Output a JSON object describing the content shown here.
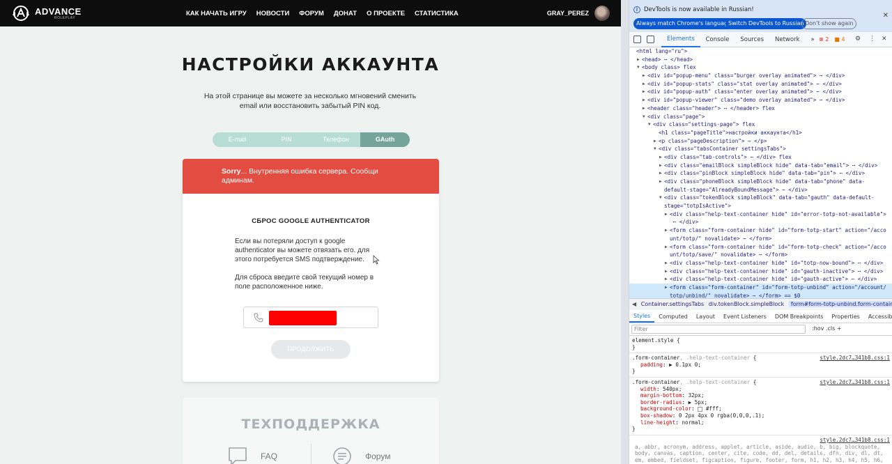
{
  "site": {
    "logo": {
      "name": "ADVANCE",
      "sub": "ROLEPLAY"
    },
    "nav": [
      "КАК НАЧАТЬ ИГРУ",
      "НОВОСТИ",
      "ФОРУМ",
      "ДОНАТ",
      "О ПРОЕКТЕ",
      "СТАТИСТИКА"
    ],
    "username": "GRAY_PEREZ",
    "page_title": "НАСТРОЙКИ АККАУНТА",
    "page_description": "На этой странице вы можете за несколько мгновений сменить email или восстановить забытый PIN код.",
    "tabs": [
      {
        "label": "E-mail",
        "active": false
      },
      {
        "label": "PIN",
        "active": false
      },
      {
        "label": "Телефон",
        "active": false
      },
      {
        "label": "GAuth",
        "active": true
      }
    ],
    "error": {
      "strong": "Sorry",
      "message": "... Внутренняя ошибка сервера. Сообщи админам."
    },
    "card": {
      "heading": "СБРОС GOOGLE AUTHENTICATOR",
      "para1": "Если вы потеряли доступ к google authenticator вы можете отвязать его. для этого потребуется SMS подтверждение.",
      "para2": "Для сброса введите свой текущий номер в поле расположенное ниже.",
      "continue_label": "ПРОДОЛЖИТЬ"
    },
    "support": {
      "title": "ТЕХПОДДЕРЖКА",
      "faq": "FAQ",
      "forum": "Форум"
    },
    "colors": {
      "header_bg": "#0d0d0d",
      "error_bg": "#e34c40",
      "tab_active": "#74a49a",
      "tab_bg": "#b8ddd5",
      "redaction": "#ff0000"
    }
  },
  "devtools": {
    "infobar": {
      "text": "DevTools is now available in Russian!",
      "btn_match": "Always match Chrome's language",
      "btn_switch": "Switch DevTools to Russian",
      "btn_dont": "Don't show again"
    },
    "tabs": [
      "Elements",
      "Console",
      "Sources",
      "Network",
      "»"
    ],
    "errors": "2",
    "warnings": "4",
    "dom_lines": [
      {
        "indent": 0,
        "text": "<html lang=\"ru\">",
        "tri": ""
      },
      {
        "indent": 1,
        "text": "<head> ⋯ </head>",
        "tri": "▶"
      },
      {
        "indent": 1,
        "text": "<body class> flex",
        "tri": "▼"
      },
      {
        "indent": 2,
        "text": "<div id=\"popup-menu\" class=\"burger overlay animated\"> ⋯ </div>",
        "tri": "▶"
      },
      {
        "indent": 2,
        "text": "<div id=\"popup-stats\" class=\"stat overlay animated\"> ⋯ </div>",
        "tri": "▶"
      },
      {
        "indent": 2,
        "text": "<div id=\"popup-auth\" class=\"enter overlay animated\"> ⋯ </div>",
        "tri": "▶"
      },
      {
        "indent": 2,
        "text": "<div id=\"popup-viewer\" class=\"demo overlay animated\"> ⋯ </div>",
        "tri": "▶"
      },
      {
        "indent": 2,
        "text": "<header class=\"header\"> ⋯ </header> flex",
        "tri": "▶"
      },
      {
        "indent": 2,
        "text": "<div class=\"page\">",
        "tri": "▼"
      },
      {
        "indent": 3,
        "text": "<div class=\"settings-page\"> flex",
        "tri": "▼"
      },
      {
        "indent": 4,
        "text": "<h1 class=\"pageTitle\">настройки аккаунта</h1>",
        "tri": ""
      },
      {
        "indent": 4,
        "text": "<p class=\"pageDescription\"> ⋯ </p>",
        "tri": "▶"
      },
      {
        "indent": 4,
        "text": "<div class=\"tabsContainer settingsTabs\">",
        "tri": "▼"
      },
      {
        "indent": 5,
        "text": "<div class=\"tab-controls\"> ⋯ </div> flex",
        "tri": "▶"
      },
      {
        "indent": 5,
        "text": "<div class=\"emailBlock simpleBlock hide\" data-tab=\"email\"> ⋯ </div>",
        "tri": "▶"
      },
      {
        "indent": 5,
        "text": "<div class=\"pinBlock simpleBlock hide\" data-tab=\"pin\"> ⋯ </div>",
        "tri": "▶"
      },
      {
        "indent": 5,
        "text": "<div class=\"phoneBlock simpleBlock hide\" data-tab=\"phone\" data-",
        "tri": "▶"
      },
      {
        "indent": 5,
        "text": "default-stage=\"AlreadyBoundMessage\"> ⋯ </div>",
        "tri": ""
      },
      {
        "indent": 5,
        "text": "<div class=\"tokenBlock simpleBlock\" data-tab=\"gauth\" data-default-",
        "tri": "▼"
      },
      {
        "indent": 5,
        "text": "stage=\"totpIsActive\">",
        "tri": ""
      },
      {
        "indent": 6,
        "text": "<div class=\"help-text-container hide\" id=\"error-totp-not-available\">",
        "tri": "▶"
      },
      {
        "indent": 6,
        "text": " ⋯ </div>",
        "tri": ""
      },
      {
        "indent": 6,
        "text": "<form class=\"form-container hide\" id=\"form-totp-start\" action=\"/acco",
        "tri": "▶"
      },
      {
        "indent": 6,
        "text": "unt/totp/\" novalidate> ⋯ </form>",
        "tri": ""
      },
      {
        "indent": 6,
        "text": "<form class=\"form-container hide\" id=\"form-totp-check\" action=\"/acco",
        "tri": "▶"
      },
      {
        "indent": 6,
        "text": "unt/totp/save/\" novalidate> ⋯ </form>",
        "tri": ""
      },
      {
        "indent": 6,
        "text": "<div class=\"help-text-container hide\" id=\"totp-now-bound\"> ⋯ </div>",
        "tri": "▶"
      },
      {
        "indent": 6,
        "text": "<div class=\"help-text-container hide\" id=\"gauth-inactive\"> ⋯ </div>",
        "tri": "▶"
      },
      {
        "indent": 6,
        "text": "<div class=\"help-text-container hide\" id=\"gauth-active\"> ⋯ </div>",
        "tri": "▶"
      },
      {
        "indent": 6,
        "text": "<form class=\"form-container\" id=\"form-totp-unbind\" action=\"/account/",
        "tri": "▶",
        "selected": true
      },
      {
        "indent": 6,
        "text": "totp/unbind/\" novalidate> ⋯ </form> == $0",
        "tri": "",
        "selected": true
      }
    ],
    "breadcrumbs": [
      "Container.settingsTabs",
      "div.tokenBlock.simpleBlock",
      "form#form-totp-unbind.form-container"
    ],
    "subtabs": [
      "Styles",
      "Computed",
      "Layout",
      "Event Listeners",
      "DOM Breakpoints",
      "Properties",
      "Accessibility"
    ],
    "filter_placeholder": "Filter",
    "filter_tools": ":hov  .cls  +",
    "styles": {
      "element_style": "element.style {",
      "rule1": {
        "selector": ".form-container",
        "inactive": ", .help-text-container",
        "source": "style.2dc7…341b8.css:1",
        "decls": [
          [
            "padding",
            "▶ 0.1px 0;"
          ]
        ]
      },
      "rule2": {
        "selector": ".form-container",
        "inactive": ", .help-text-container",
        "source": "style.2dc7…341b8.css:1",
        "decls": [
          [
            "width",
            "540px;"
          ],
          [
            "margin-bottom",
            "32px;"
          ],
          [
            "border-radius",
            "▶ 5px;"
          ],
          [
            "background-color",
            "#fff;"
          ],
          [
            "box-shadow",
            "0 2px 4px 0 rgba(0,0,0,.1);"
          ],
          [
            "line-height",
            "normal;"
          ]
        ]
      },
      "rule3_source": "style.2dc7…341b8.css:1",
      "tag_list": "a, abbr, acronym, address, applet, article, aside, audio, b, big, blockquote, body, canvas, caption, center, cite, code, dd, del, details, dfn, div, dl, dt, em, embed, fieldset, figcaption, figure, footer, form, h1, h2, h3, h4, h5, h6, header, hgroup, html, i, iframe, img, ins, kbd,"
    }
  }
}
